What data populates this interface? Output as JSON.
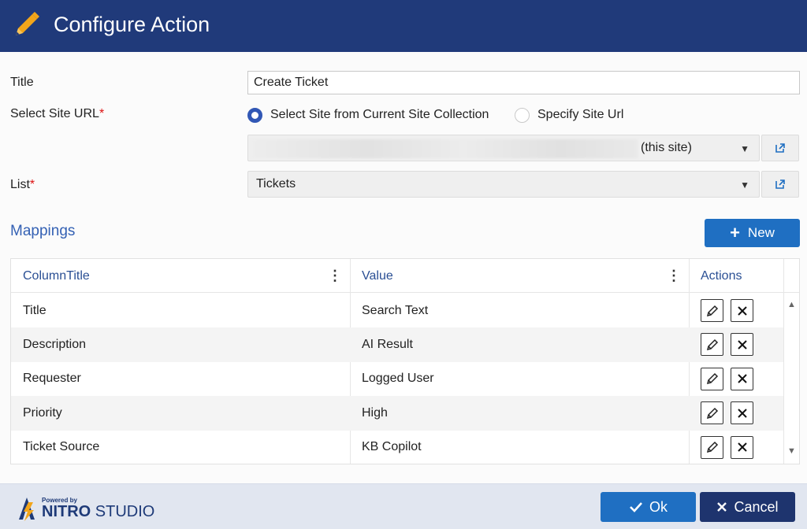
{
  "header": {
    "title": "Configure Action",
    "icon": "pencil-icon"
  },
  "form": {
    "title_label": "Title",
    "title_value": "Create Ticket",
    "site_url_label": "Select Site URL",
    "required_mark": "*",
    "radio_current": "Select Site from Current Site Collection",
    "radio_specify": "Specify Site Url",
    "site_suffix": "(this site)",
    "list_label": "List",
    "list_value": "Tickets"
  },
  "mappings": {
    "title": "Mappings",
    "new_label": "New",
    "columns": [
      "ColumnTitle",
      "Value",
      "Actions"
    ],
    "rows": [
      {
        "column": "Title",
        "value": "Search Text"
      },
      {
        "column": "Description",
        "value": "AI Result"
      },
      {
        "column": "Requester",
        "value": "Logged User"
      },
      {
        "column": "Priority",
        "value": "High"
      },
      {
        "column": "Ticket Source",
        "value": "KB Copilot"
      }
    ]
  },
  "footer": {
    "powered": "Powered by",
    "brand_bold": "NITRO",
    "brand_rest": " STUDIO",
    "ok_label": "Ok",
    "cancel_label": "Cancel"
  },
  "colors": {
    "header": "#203a7a",
    "accent": "#1f6fc2",
    "cancel": "#1e346e",
    "link": "#3461b4",
    "pencil": "#f2a51a"
  }
}
